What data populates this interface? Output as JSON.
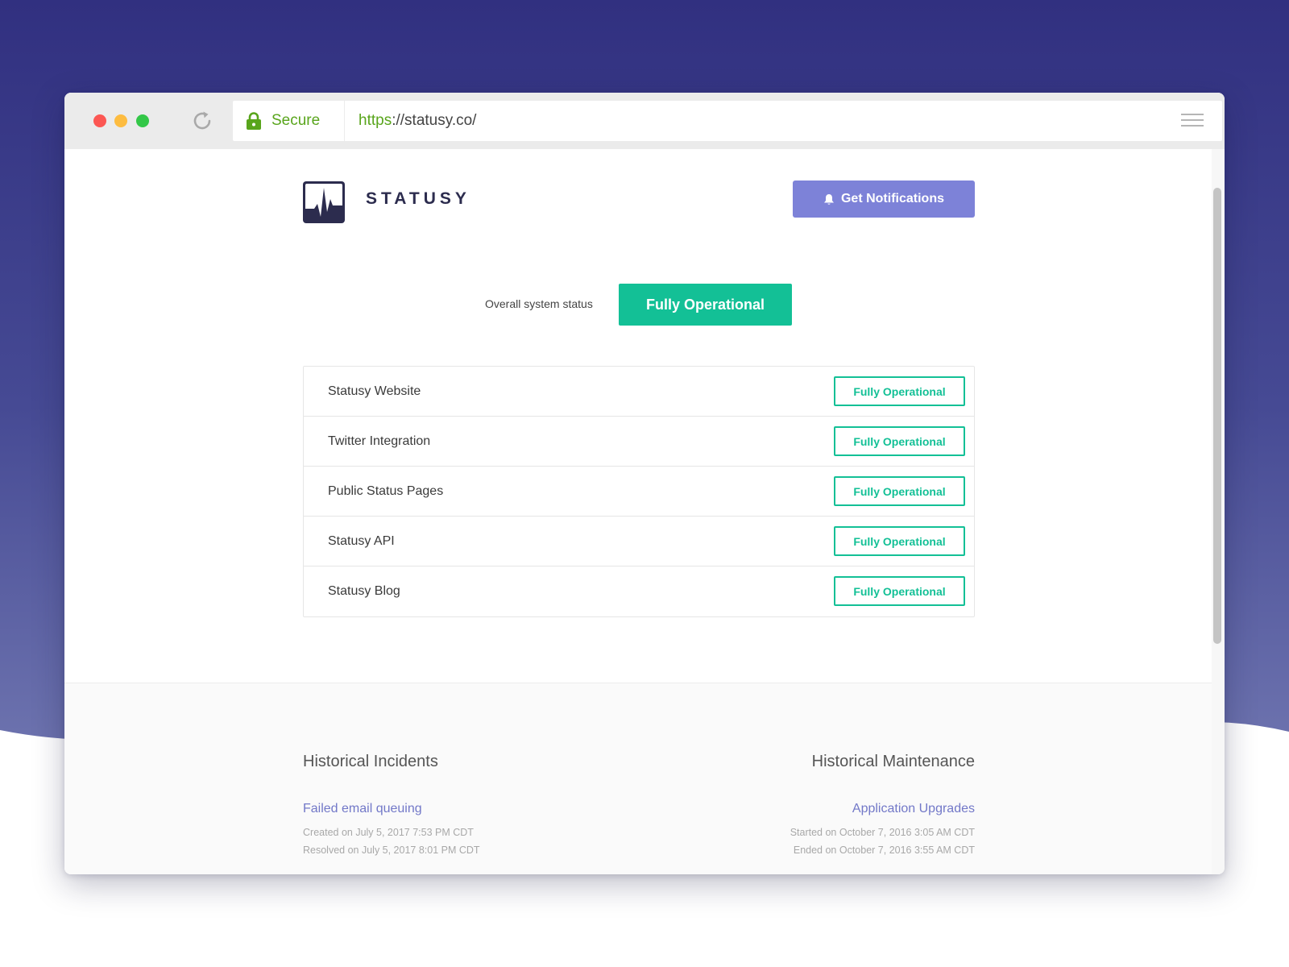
{
  "colors": {
    "background_purple": "#32337f",
    "operational_green": "#13c096",
    "notify_button": "#7d82d8",
    "link": "#7278c8",
    "secure_green": "#59a51c"
  },
  "browser": {
    "secure_label": "Secure",
    "url_scheme": "https",
    "url_rest": "://statusy.co/",
    "icons": {
      "reload": "reload-icon",
      "lock": "lock-icon",
      "menu": "hamburger-menu-icon"
    }
  },
  "header": {
    "brand": "STATUSY",
    "notify_button": "Get Notifications",
    "notify_icon": "bell-icon"
  },
  "overall": {
    "label": "Overall system status",
    "status": "Fully Operational"
  },
  "components": [
    {
      "name": "Statusy Website",
      "status": "Fully Operational"
    },
    {
      "name": "Twitter Integration",
      "status": "Fully Operational"
    },
    {
      "name": "Public Status Pages",
      "status": "Fully Operational"
    },
    {
      "name": "Statusy API",
      "status": "Fully Operational"
    },
    {
      "name": "Statusy Blog",
      "status": "Fully Operational"
    }
  ],
  "history": {
    "incidents_title": "Historical Incidents",
    "maintenance_title": "Historical Maintenance",
    "incident": {
      "title": "Failed email queuing",
      "created": "Created on July 5, 2017 7:53 PM CDT",
      "resolved": "Resolved on July 5, 2017 8:01 PM CDT"
    },
    "maintenance": {
      "title": "Application Upgrades",
      "started": "Started on October 7, 2016 3:05 AM CDT",
      "ended": "Ended on October 7, 2016 3:55 AM CDT"
    }
  }
}
